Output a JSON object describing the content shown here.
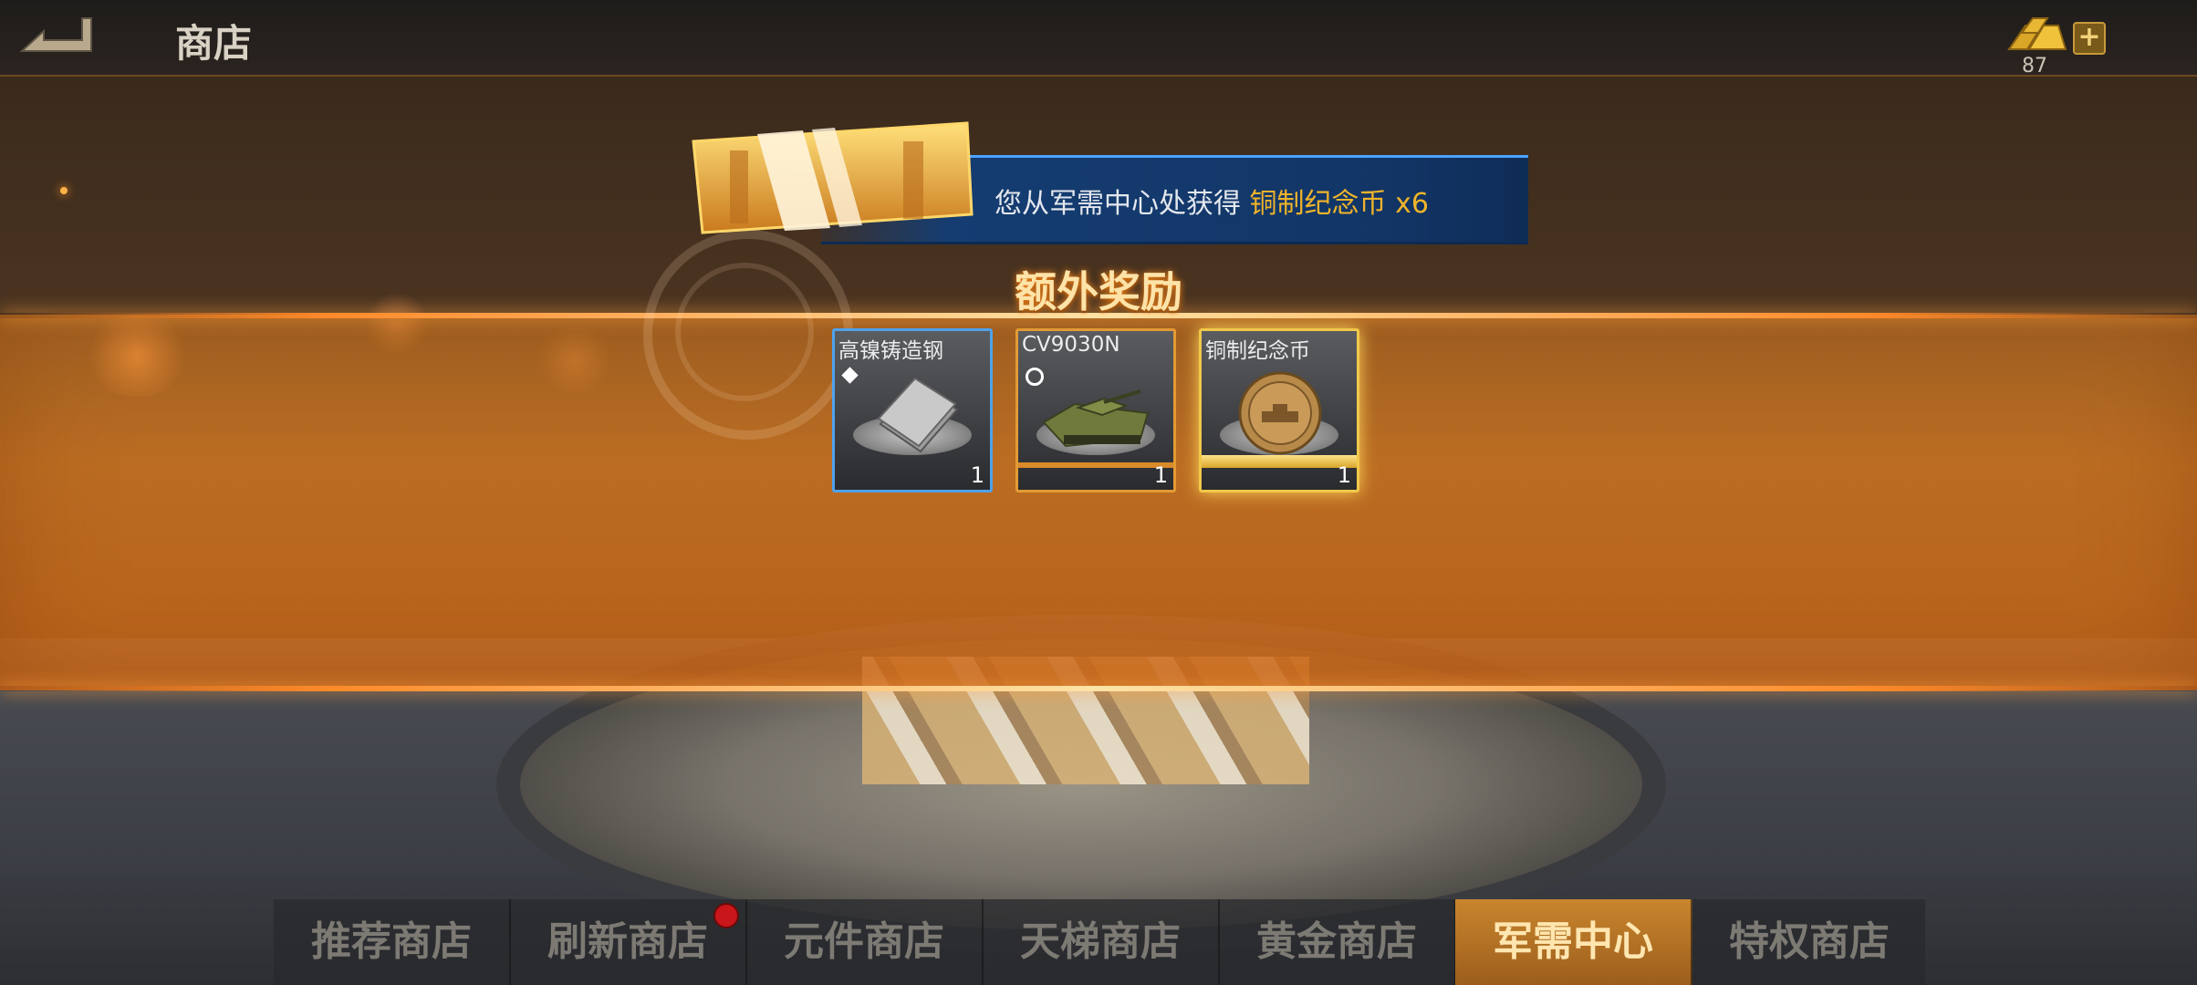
{
  "header": {
    "back_icon": "back-arrow-icon",
    "title": "商店",
    "currency_icon": "gold-bars-icon",
    "currency_amount": "87",
    "add_label": "+"
  },
  "notice": {
    "prefix": "您从军需中心处获得 ",
    "item": "铜制纪念币 x6",
    "icon": "supply-crate-icon"
  },
  "bonus": {
    "title": "额外奖励",
    "rewards": [
      {
        "name": "高镍铸造钢",
        "qty": "1",
        "rarity_icon": "diamond-icon",
        "item_icon": "steel-plate-icon",
        "border": "#4fa2ea"
      },
      {
        "name": "CV9030N",
        "qty": "1",
        "rarity_icon": "circle-icon",
        "item_icon": "tank-icon",
        "border": "#e39a34"
      },
      {
        "name": "铜制纪念币",
        "qty": "1",
        "rarity_icon": "",
        "item_icon": "coin-icon",
        "border": "#f0c84a"
      }
    ]
  },
  "tabs": [
    {
      "label": "推荐商店",
      "active": false
    },
    {
      "label": "刷新商店",
      "active": false,
      "badge": true
    },
    {
      "label": "元件商店",
      "active": false
    },
    {
      "label": "天梯商店",
      "active": false
    },
    {
      "label": "黄金商店",
      "active": false
    },
    {
      "label": "军需中心",
      "active": true
    },
    {
      "label": "特权商店",
      "active": false
    }
  ],
  "colors": {
    "accent": "#e39a34",
    "highlight": "#f0b42a",
    "notice_bg": "#153d72",
    "badge": "#c8161a"
  }
}
